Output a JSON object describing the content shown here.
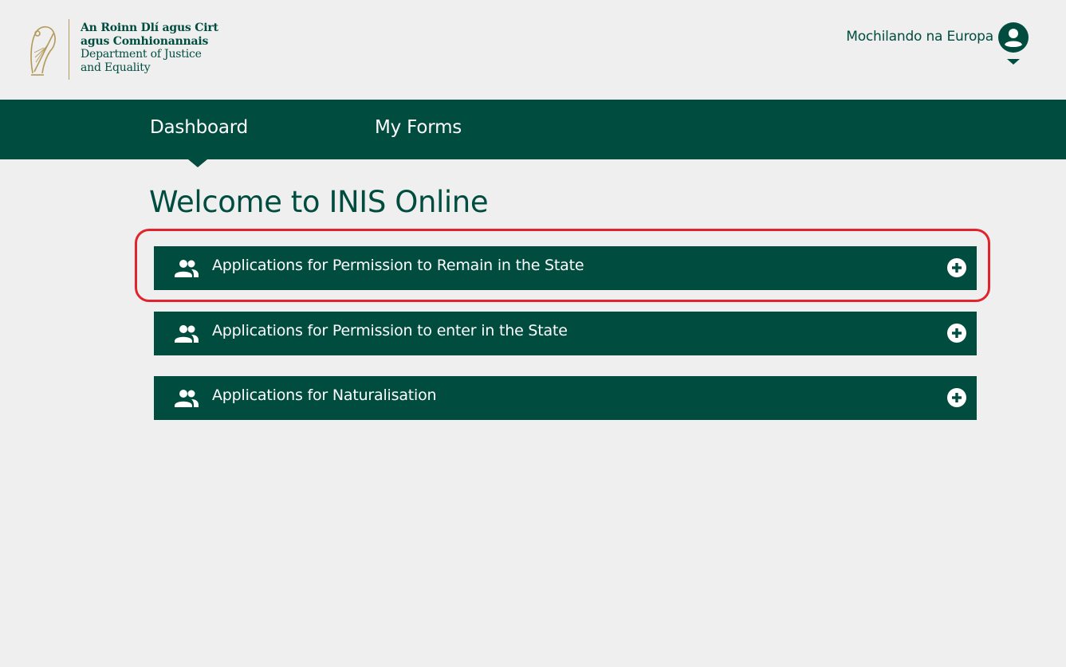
{
  "header": {
    "logo": {
      "irish_line1": "An Roinn Dlí agus Cirt",
      "irish_line2": "agus Comhionannais",
      "english_line1": "Department of Justice",
      "english_line2": "and Equality"
    },
    "user_name": "Mochilando na Europa"
  },
  "nav": {
    "items": [
      {
        "label": "Dashboard",
        "active": true
      },
      {
        "label": "My Forms",
        "active": false
      }
    ]
  },
  "main": {
    "welcome": "Welcome to INIS Online",
    "accordions": [
      {
        "label": "Applications for Permission to Remain in the State",
        "icon": "people-icon",
        "action_icon": "plus-circle-icon",
        "highlighted": true
      },
      {
        "label": "Applications for Permission to enter in the State",
        "icon": "people-icon",
        "action_icon": "plus-circle-icon",
        "highlighted": false
      },
      {
        "label": "Applications for Naturalisation",
        "icon": "people-icon",
        "action_icon": "plus-circle-icon",
        "highlighted": false
      }
    ]
  },
  "colors": {
    "brand": "#004d40",
    "background": "#efefef",
    "highlight": "#e0232c",
    "logo_gold": "#b49a5a"
  }
}
